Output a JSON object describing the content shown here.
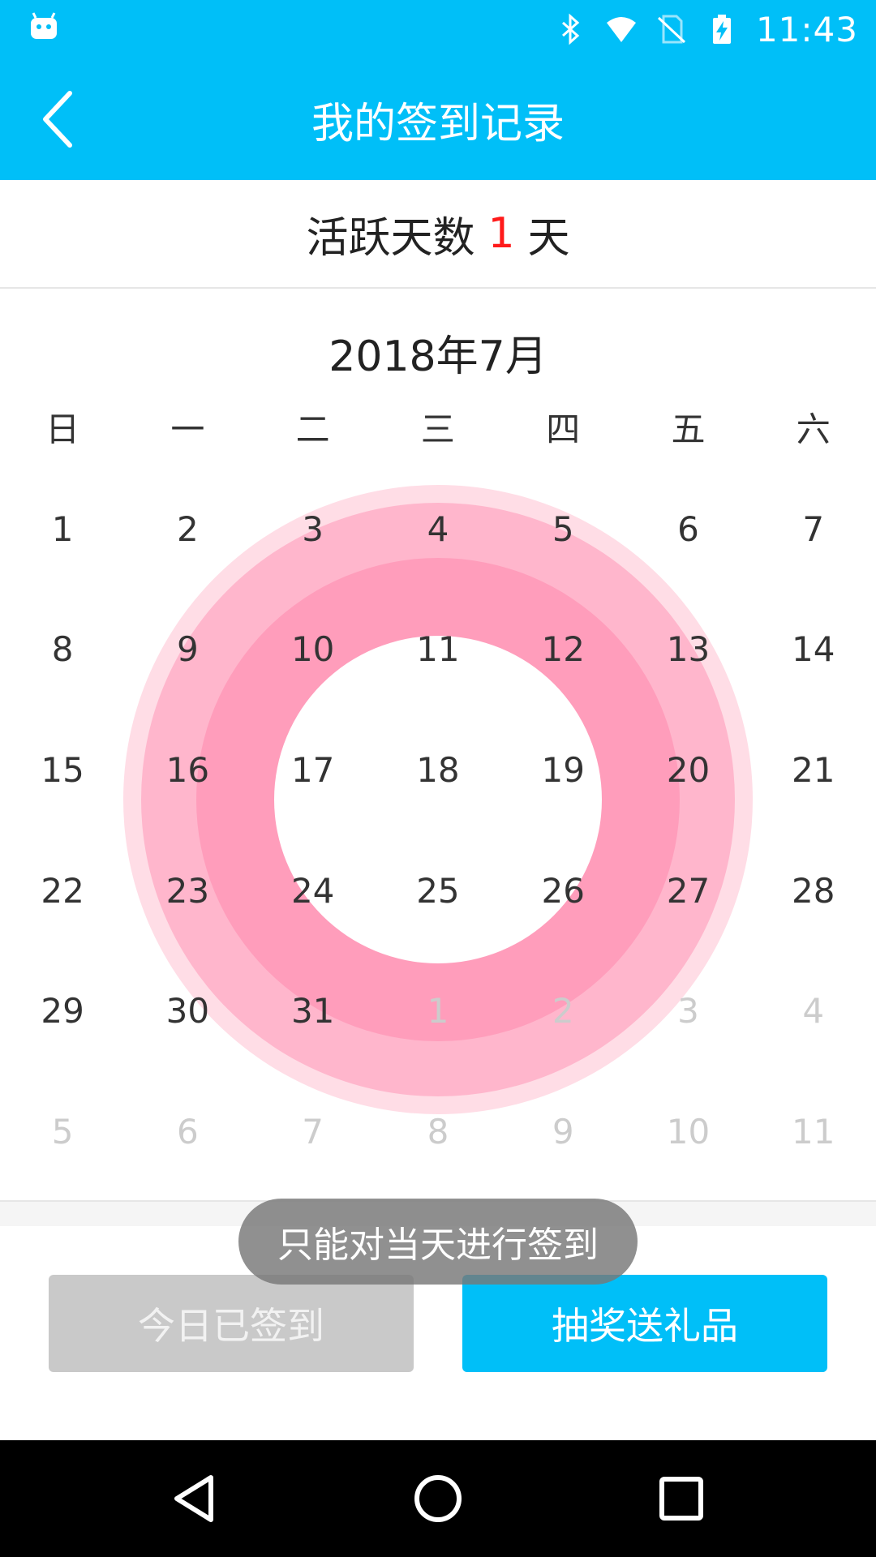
{
  "status_bar": {
    "time": "11:43",
    "icons": [
      "android-icon",
      "bluetooth-icon",
      "wifi-icon",
      "no-sim-icon",
      "battery-charging-icon"
    ]
  },
  "app_bar": {
    "title": "我的签到记录",
    "back_icon": "chevron-left-icon"
  },
  "active_days": {
    "prefix": "活跃天数",
    "count": "1",
    "suffix": "天",
    "count_color": "#ff1a1a"
  },
  "calendar": {
    "month_title": "2018年7月",
    "weekdays": [
      "日",
      "一",
      "二",
      "三",
      "四",
      "五",
      "六"
    ],
    "days": [
      {
        "label": "1",
        "in_month": true
      },
      {
        "label": "2",
        "in_month": true
      },
      {
        "label": "3",
        "in_month": true
      },
      {
        "label": "4",
        "in_month": true
      },
      {
        "label": "5",
        "in_month": true
      },
      {
        "label": "6",
        "in_month": true
      },
      {
        "label": "7",
        "in_month": true
      },
      {
        "label": "8",
        "in_month": true
      },
      {
        "label": "9",
        "in_month": true
      },
      {
        "label": "10",
        "in_month": true
      },
      {
        "label": "11",
        "in_month": true
      },
      {
        "label": "12",
        "in_month": true
      },
      {
        "label": "13",
        "in_month": true
      },
      {
        "label": "14",
        "in_month": true
      },
      {
        "label": "15",
        "in_month": true
      },
      {
        "label": "16",
        "in_month": true
      },
      {
        "label": "17",
        "in_month": true
      },
      {
        "label": "18",
        "in_month": true
      },
      {
        "label": "19",
        "in_month": true
      },
      {
        "label": "20",
        "in_month": true
      },
      {
        "label": "21",
        "in_month": true
      },
      {
        "label": "22",
        "in_month": true
      },
      {
        "label": "23",
        "in_month": true
      },
      {
        "label": "24",
        "in_month": true
      },
      {
        "label": "25",
        "in_month": true
      },
      {
        "label": "26",
        "in_month": true
      },
      {
        "label": "27",
        "in_month": true
      },
      {
        "label": "28",
        "in_month": true
      },
      {
        "label": "29",
        "in_month": true
      },
      {
        "label": "30",
        "in_month": true
      },
      {
        "label": "31",
        "in_month": true
      },
      {
        "label": "1",
        "in_month": false
      },
      {
        "label": "2",
        "in_month": false
      },
      {
        "label": "3",
        "in_month": false
      },
      {
        "label": "4",
        "in_month": false
      },
      {
        "label": "5",
        "in_month": false
      },
      {
        "label": "6",
        "in_month": false
      },
      {
        "label": "7",
        "in_month": false
      },
      {
        "label": "8",
        "in_month": false
      },
      {
        "label": "9",
        "in_month": false
      },
      {
        "label": "10",
        "in_month": false
      },
      {
        "label": "11",
        "in_month": false
      }
    ],
    "ring_colors": [
      "#ffdde6",
      "#ffb6cc",
      "#ff9dbb"
    ]
  },
  "buttons": {
    "checked_in": "今日已签到",
    "lottery": "抽奖送礼品"
  },
  "toast": {
    "message": "只能对当天进行签到"
  },
  "nav_bar": {
    "icons": [
      "back-triangle-icon",
      "home-circle-icon",
      "recents-square-icon"
    ]
  },
  "colors": {
    "accent": "#00bff8",
    "disabled_button": "#c9c9c9"
  }
}
